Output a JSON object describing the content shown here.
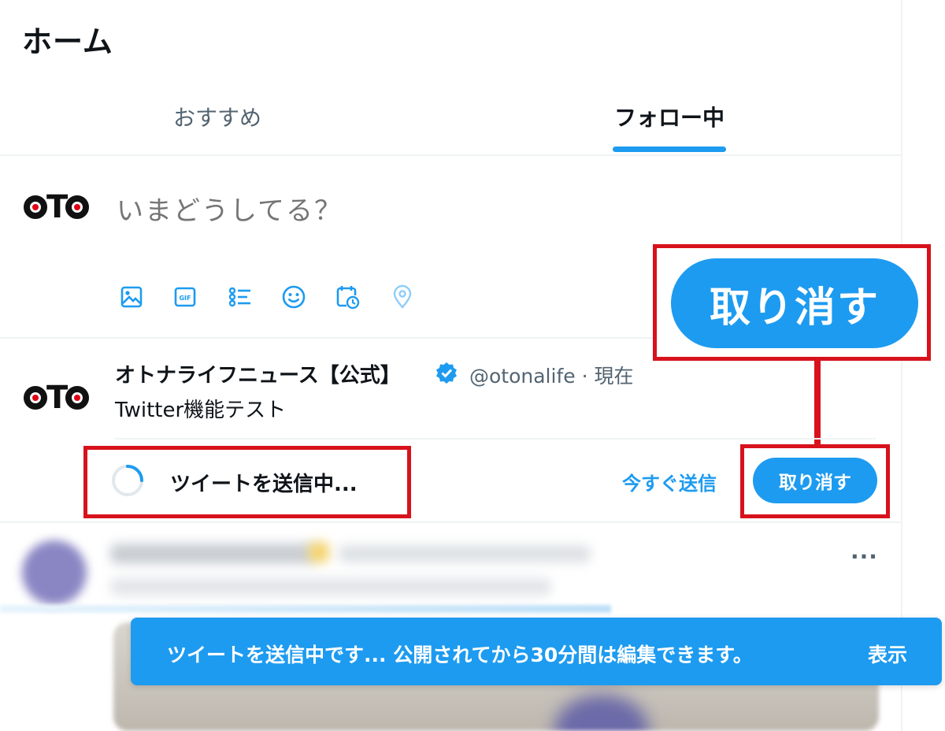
{
  "header": {
    "title": "ホーム"
  },
  "tabs": [
    {
      "label": "おすすめ",
      "active": false
    },
    {
      "label": "フォロー中",
      "active": true
    }
  ],
  "compose": {
    "avatar_text": "OTO",
    "placeholder": "いまどうしてる？",
    "tools": [
      "image-icon",
      "gif-icon",
      "poll-icon",
      "emoji-icon",
      "schedule-icon",
      "location-icon"
    ]
  },
  "callout": {
    "undo_label": "取り消す"
  },
  "pending_tweet": {
    "avatar_text": "OTO",
    "name": "オトナライフニュース【公式】",
    "handle_time": "@otonalife · 現在",
    "text": "Twitter機能テスト",
    "status": "ツイートを送信中...",
    "send_now_label": "今すぐ送信",
    "undo_label": "取り消す"
  },
  "feed": {
    "more_label": "···"
  },
  "toast": {
    "message": "ツイートを送信中です... 公開されてから30分間は編集できます。",
    "action_label": "表示"
  },
  "colors": {
    "accent": "#1d9bf0",
    "highlight_frame": "#d7121c",
    "text_secondary": "#536471"
  }
}
